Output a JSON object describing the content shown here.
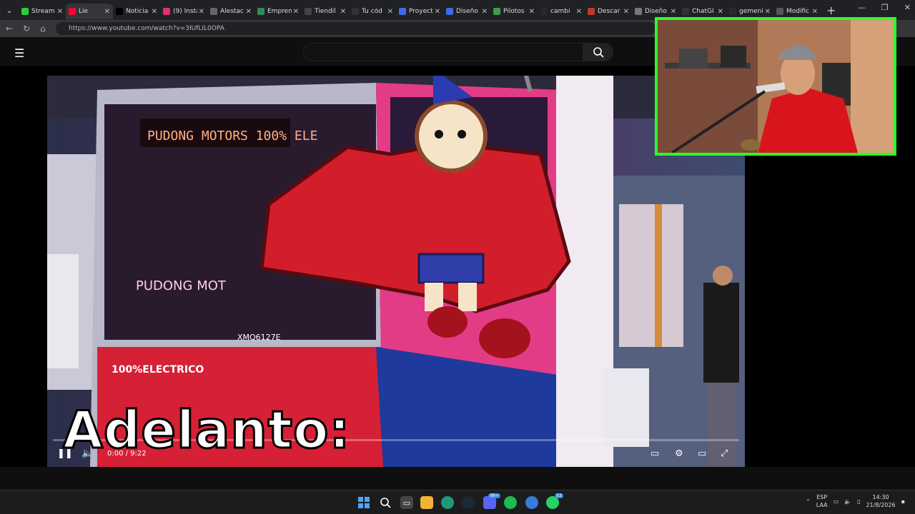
{
  "tabs": [
    {
      "label": "Stream",
      "color": "#2ecc40"
    },
    {
      "label": "Lie",
      "color": "#ff0033"
    },
    {
      "label": "Noticia",
      "color": "#000000"
    },
    {
      "label": "(9) Insta",
      "color": "#e1306c"
    },
    {
      "label": "Alestac",
      "color": "#666666"
    },
    {
      "label": "Empren",
      "color": "#2e8b57"
    },
    {
      "label": "Tiendil",
      "color": "#444444"
    },
    {
      "label": "Tu cód",
      "color": "#333333"
    },
    {
      "label": "Proyect",
      "color": "#4169e1"
    },
    {
      "label": "Diseño",
      "color": "#4169e1"
    },
    {
      "label": "Pilotos",
      "color": "#3c9d52"
    },
    {
      "label": "cambi",
      "color": "#2a2a2a"
    },
    {
      "label": "Descar",
      "color": "#c0392b"
    },
    {
      "label": "Diseño",
      "color": "#777777"
    },
    {
      "label": "ChatGI",
      "color": "#333333"
    },
    {
      "label": "gemeni",
      "color": "#2a2a2a"
    },
    {
      "label": "Modific",
      "color": "#555555"
    }
  ],
  "address": {
    "url": "https://www.youtube.com/watch?v=3IUfLIL0OPA"
  },
  "video": {
    "caption": "Adelanto:",
    "time": "0:00 / 9:22",
    "destination_sign": "PUDONG MOTORS 100% ELE",
    "bus_text": "100%ELECTRICO",
    "plate": "XMQ6127E"
  },
  "taskbar": {
    "lang_top": "ESP",
    "lang_bottom": "LAA",
    "time": "14:30",
    "date": "21/8/2026",
    "discord_badge": "99+",
    "whatsapp_badge": "53"
  }
}
